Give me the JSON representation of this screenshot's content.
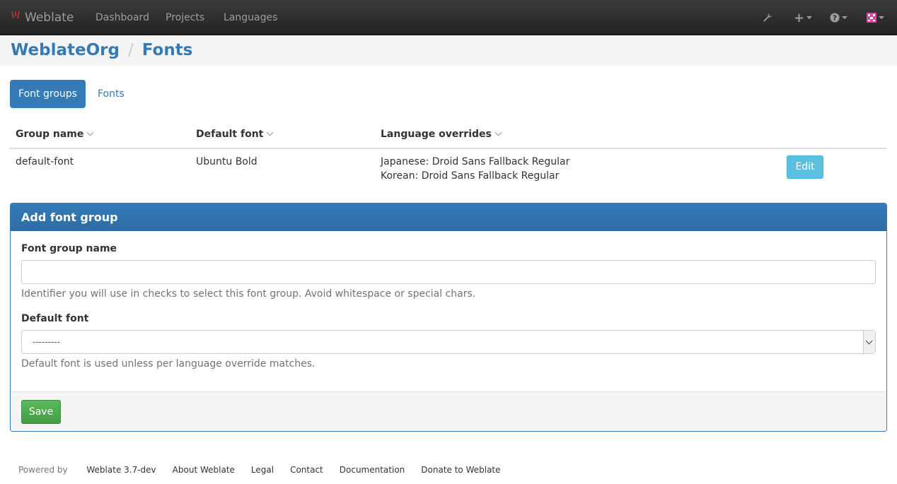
{
  "navbar": {
    "brand": "Weblate",
    "links": [
      "Dashboard",
      "Projects",
      "Languages"
    ],
    "icons": [
      "wrench-icon",
      "plus-icon",
      "help-icon",
      "avatar"
    ]
  },
  "breadcrumb": {
    "org": "WeblateOrg",
    "page": "Fonts"
  },
  "tabs": {
    "active": "Font groups",
    "other": "Fonts"
  },
  "table": {
    "headers": [
      "Group name",
      "Default font",
      "Language overrides"
    ],
    "row": {
      "group_name": "default-font",
      "default_font": "Ubuntu Bold",
      "overrides": [
        "Japanese: Droid Sans Fallback Regular",
        "Korean: Droid Sans Fallback Regular"
      ],
      "edit_label": "Edit"
    }
  },
  "form": {
    "title": "Add font group",
    "name_label": "Font group name",
    "name_value": "",
    "name_help": "Identifier you will use in checks to select this font group. Avoid whitespace or special chars.",
    "font_label": "Default font",
    "font_selected": "---------",
    "font_help": "Default font is used unless per language override matches.",
    "save_label": "Save"
  },
  "footer": {
    "powered_prefix": "Powered by",
    "powered_product": "Weblate 3.7-dev",
    "links": [
      "About Weblate",
      "Legal",
      "Contact",
      "Documentation",
      "Donate to Weblate"
    ]
  },
  "colors": {
    "primary": "#337ab7",
    "info": "#5bc0de",
    "success": "#5cb85c"
  }
}
